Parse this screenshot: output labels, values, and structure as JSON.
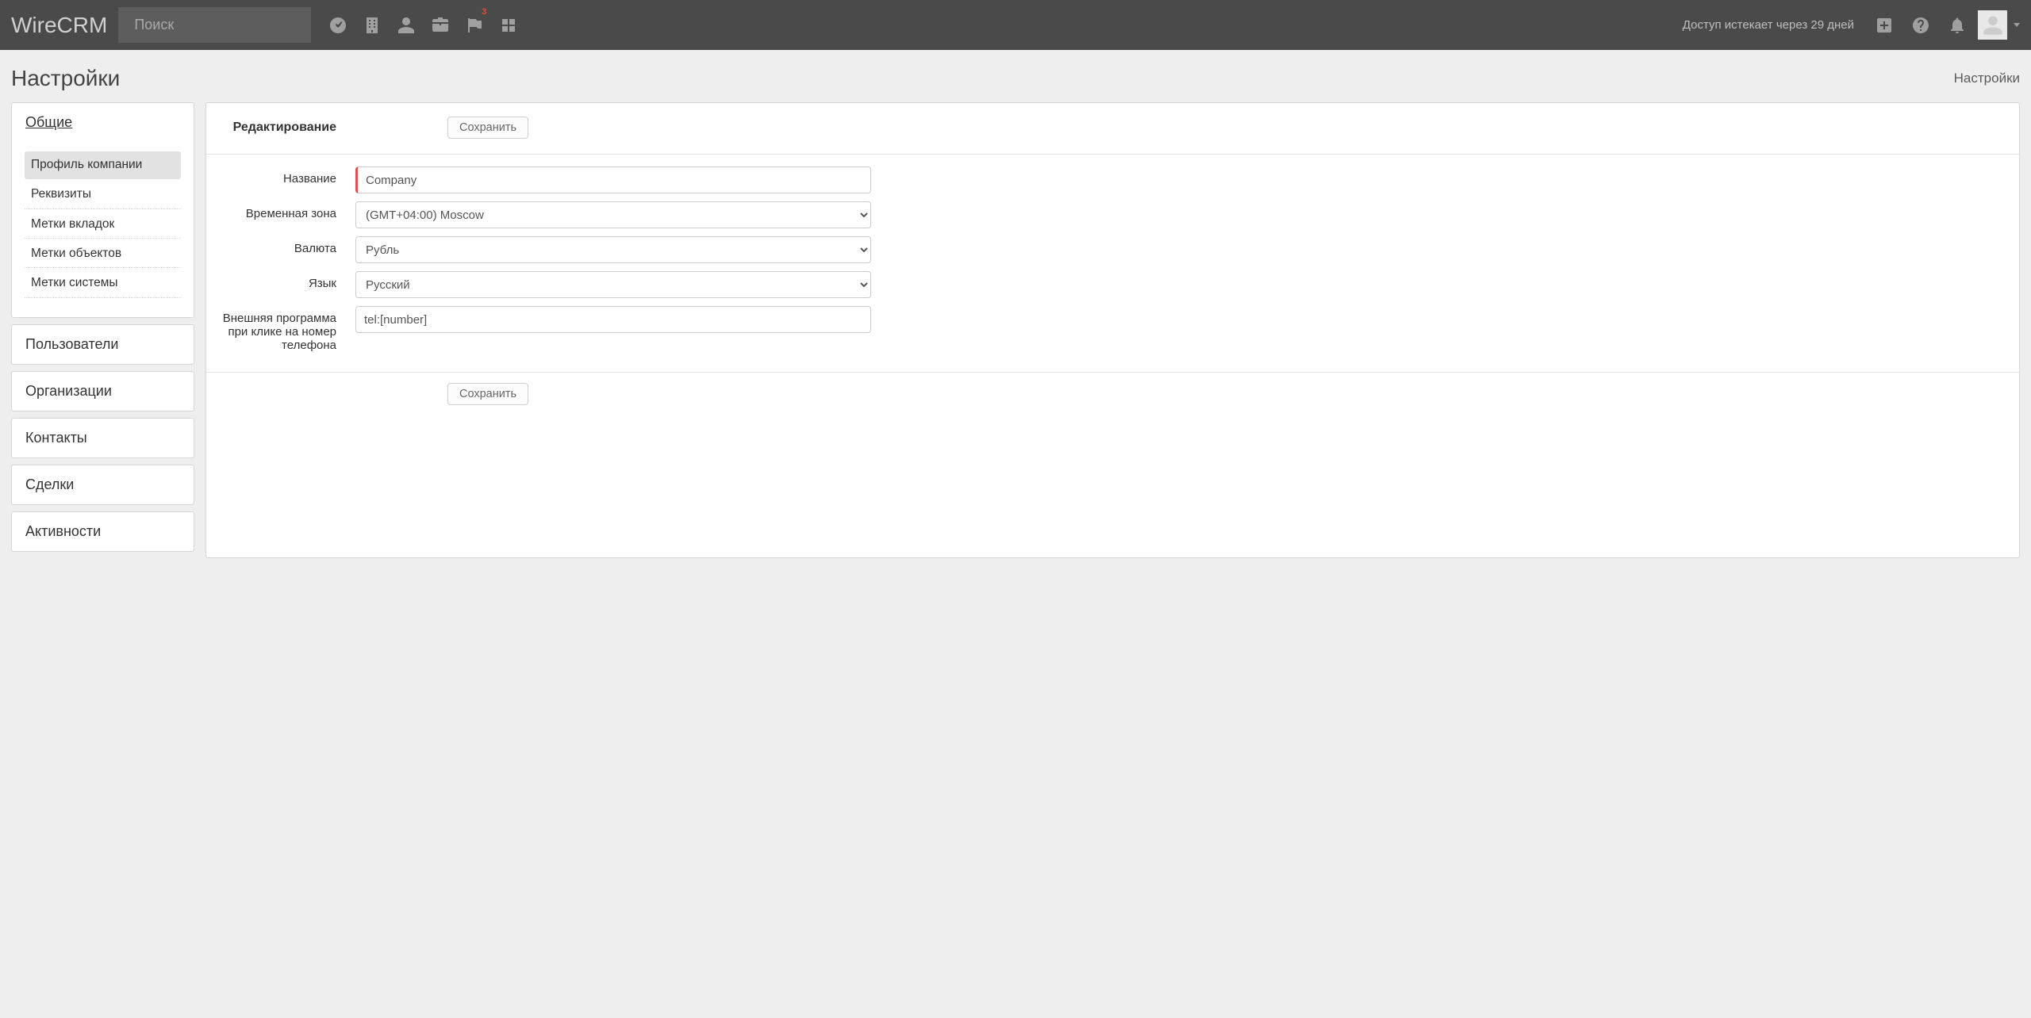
{
  "brand": "WireCRM",
  "search": {
    "placeholder": "Поиск"
  },
  "topnav": {
    "flag_badge": "3"
  },
  "access_text": "Доступ истекает через 29 дней",
  "page": {
    "title": "Настройки",
    "breadcrumb": "Настройки"
  },
  "sidebar": {
    "general": {
      "label": "Общие",
      "items": [
        {
          "label": "Профиль компании"
        },
        {
          "label": "Реквизиты"
        },
        {
          "label": "Метки вкладок"
        },
        {
          "label": "Метки объектов"
        },
        {
          "label": "Метки системы"
        }
      ]
    },
    "sections": [
      {
        "label": "Пользователи"
      },
      {
        "label": "Организации"
      },
      {
        "label": "Контакты"
      },
      {
        "label": "Сделки"
      },
      {
        "label": "Активности"
      }
    ]
  },
  "form": {
    "edit_label": "Редактирование",
    "save_button": "Сохранить",
    "fields": {
      "name": {
        "label": "Название",
        "value": "Company"
      },
      "timezone": {
        "label": "Временная зона",
        "value": "(GMT+04:00) Moscow"
      },
      "currency": {
        "label": "Валюта",
        "value": "Рубль"
      },
      "language": {
        "label": "Язык",
        "value": "Русский"
      },
      "tel_program": {
        "label": "Внешняя программа при клике на номер телефона",
        "value": "tel:[number]"
      }
    }
  }
}
